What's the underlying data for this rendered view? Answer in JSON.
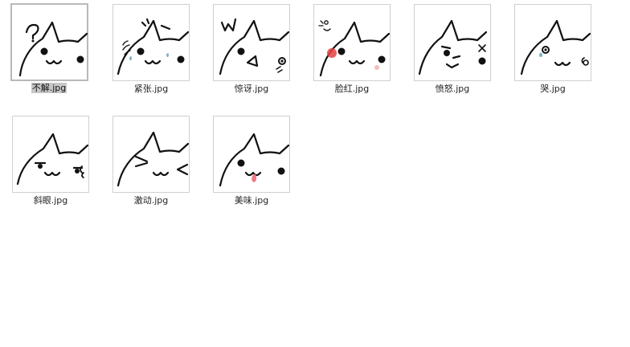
{
  "files": [
    {
      "name": "不解.jpg",
      "selected": true,
      "icon": "cat-confused-icon"
    },
    {
      "name": "紧张.jpg",
      "selected": false,
      "icon": "cat-nervous-icon"
    },
    {
      "name": "惊讶.jpg",
      "selected": false,
      "icon": "cat-surprised-icon"
    },
    {
      "name": "脸红.jpg",
      "selected": false,
      "icon": "cat-blush-icon"
    },
    {
      "name": "愤怒.jpg",
      "selected": false,
      "icon": "cat-angry-icon"
    },
    {
      "name": "哭.jpg",
      "selected": false,
      "icon": "cat-crying-icon"
    },
    {
      "name": "斜眼.jpg",
      "selected": false,
      "icon": "cat-squint-icon"
    },
    {
      "name": "激动.jpg",
      "selected": false,
      "icon": "cat-excited-icon"
    },
    {
      "name": "美味.jpg",
      "selected": false,
      "icon": "cat-tasty-icon"
    }
  ],
  "colors": {
    "blush": "#e8413f",
    "tongue": "#f07a86",
    "sweat": "#7fb0c8",
    "selection": "#c7c7c7"
  }
}
